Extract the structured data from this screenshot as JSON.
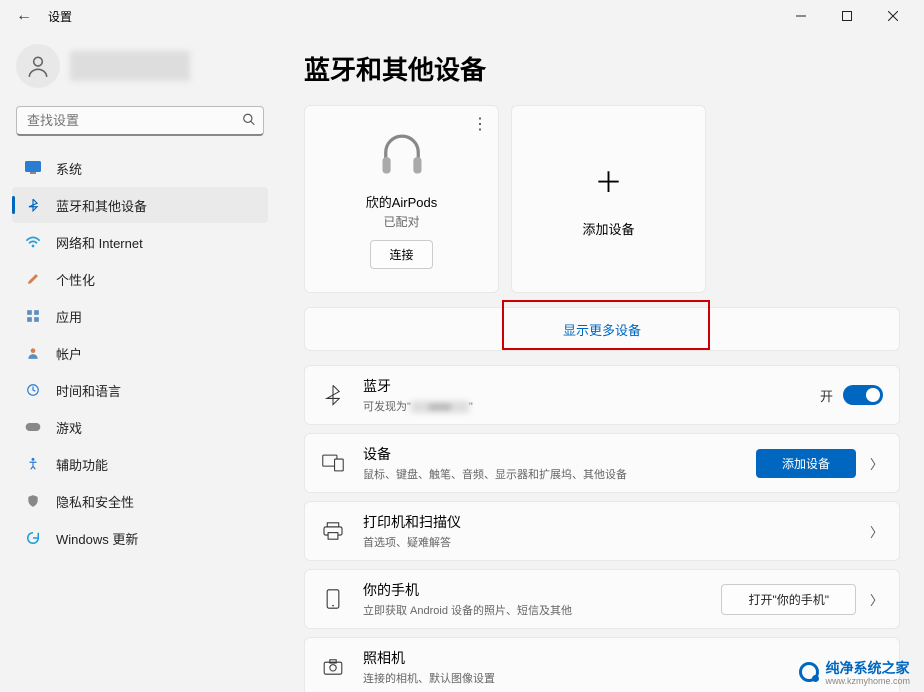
{
  "window": {
    "title": "设置"
  },
  "search": {
    "placeholder": "查找设置"
  },
  "nav": {
    "system": "系统",
    "bluetooth": "蓝牙和其他设备",
    "network": "网络和 Internet",
    "personalize": "个性化",
    "apps": "应用",
    "accounts": "帐户",
    "time": "时间和语言",
    "gaming": "游戏",
    "accessibility": "辅助功能",
    "privacy": "隐私和安全性",
    "update": "Windows 更新"
  },
  "page": {
    "title": "蓝牙和其他设备",
    "device_card": {
      "name": "欣的AirPods",
      "status": "已配对",
      "connect": "连接"
    },
    "add_card": {
      "label": "添加设备"
    },
    "more": "显示更多设备",
    "bt_row": {
      "title": "蓝牙",
      "desc_prefix": "可发现为\"",
      "desc_suffix": "\"",
      "state": "开"
    },
    "devices_row": {
      "title": "设备",
      "desc": "鼠标、键盘、触笔、音频、显示器和扩展坞、其他设备",
      "button": "添加设备"
    },
    "printers_row": {
      "title": "打印机和扫描仪",
      "desc": "首选项、疑难解答"
    },
    "phone_row": {
      "title": "你的手机",
      "desc": "立即获取 Android 设备的照片、短信及其他",
      "button": "打开\"你的手机\""
    },
    "camera_row": {
      "title": "照相机",
      "desc": "连接的相机、默认图像设置"
    }
  },
  "watermark": {
    "main": "纯净系统之家",
    "sub": "www.kzmyhome.com"
  }
}
